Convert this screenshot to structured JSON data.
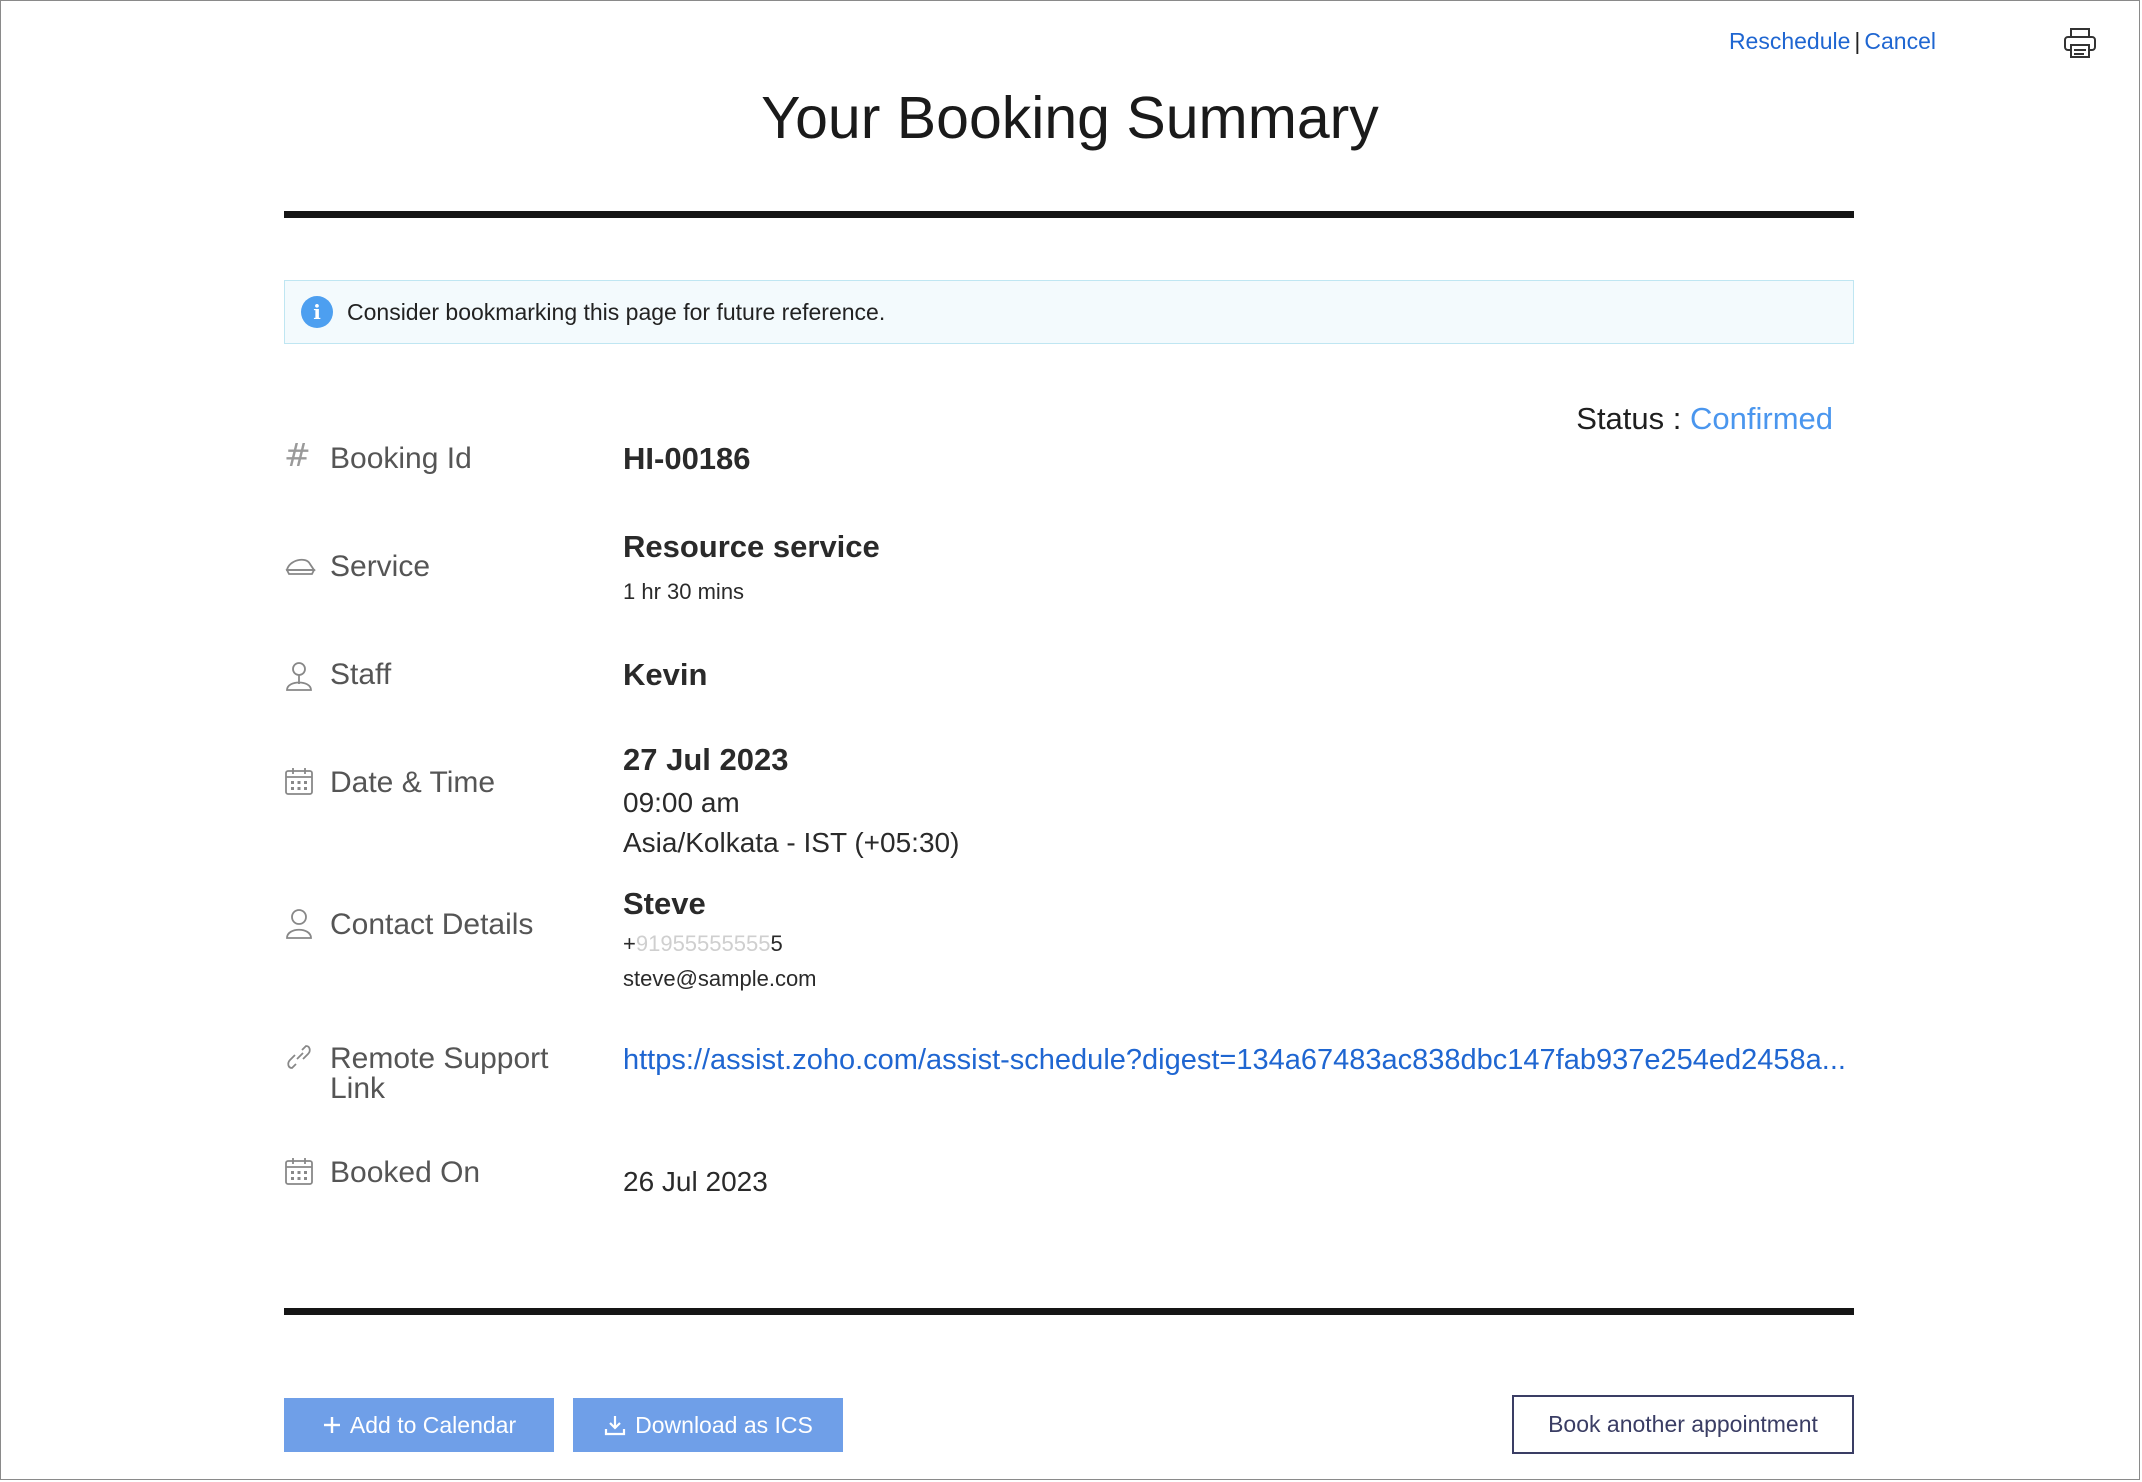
{
  "header": {
    "reschedule_label": "Reschedule",
    "separator": "|",
    "cancel_label": "Cancel",
    "print_icon": "printer-icon",
    "title": "Your Booking Summary"
  },
  "info_banner": {
    "icon": "info-icon",
    "icon_glyph": "i",
    "text": "Consider bookmarking this page for future reference."
  },
  "status": {
    "label": "Status :",
    "value": "Confirmed"
  },
  "details": {
    "booking_id": {
      "icon": "hash-icon",
      "icon_glyph": "#",
      "label": "Booking Id",
      "value": "HI-00186"
    },
    "service": {
      "icon": "service-icon",
      "label": "Service",
      "name": "Resource service",
      "duration": "1 hr 30 mins"
    },
    "staff": {
      "icon": "staff-icon",
      "label": "Staff",
      "name": "Kevin"
    },
    "date_time": {
      "icon": "calendar-icon",
      "label": "Date & Time",
      "date": "27 Jul 2023",
      "time": "09:00 am",
      "timezone": "Asia/Kolkata - IST (+05:30)"
    },
    "contact": {
      "icon": "user-icon",
      "label": "Contact Details",
      "name": "Steve",
      "phone_prefix": "+",
      "phone_masked": "91955555555",
      "phone_suffix": "5",
      "email": "steve@sample.com"
    },
    "remote_support": {
      "icon": "link-icon",
      "label_line1": "Remote Support",
      "label_line2": "Link",
      "url": "https://assist.zoho.com/assist-schedule?digest=134a67483ac838dbc147fab937e254ed2458a..."
    },
    "booked_on": {
      "icon": "calendar-icon",
      "label": "Booked On",
      "value": "26 Jul 2023"
    }
  },
  "actions": {
    "add_calendar_label": "Add to Calendar",
    "download_ics_label": "Download as ICS",
    "book_another_label": "Book another appointment"
  },
  "colors": {
    "link": "#1f66d1",
    "status_confirmed": "#4a96ee",
    "primary_button": "#6f9fe8",
    "outline_button": "#3a3d64",
    "info_bg": "#f3fafd"
  }
}
